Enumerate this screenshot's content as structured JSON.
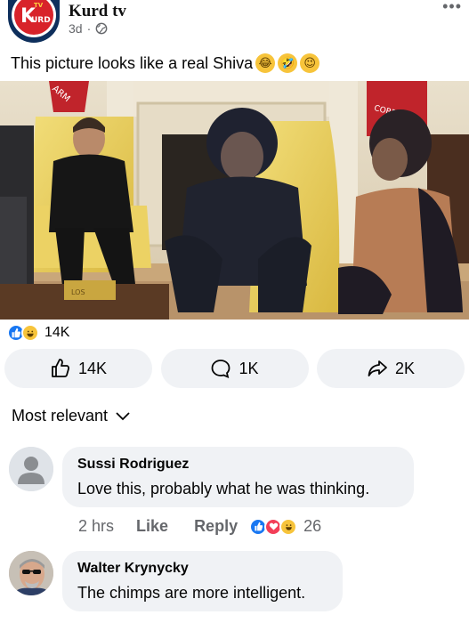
{
  "post": {
    "page_name": "Kurd tv",
    "time": "3d",
    "separator": "·",
    "caption": "This picture looks like a real Shiva",
    "logo_text": "KURD",
    "logo_badge": "TV",
    "caption_emojis": [
      "😂",
      "🤣",
      "😉"
    ],
    "photo_text": {
      "flag_left": "ARM",
      "flag_right": "CORPS",
      "box_label": "LOS"
    }
  },
  "reactions": {
    "count": "14K"
  },
  "actions": {
    "like": "14K",
    "comment": "1K",
    "share": "2K"
  },
  "sort_label": "Most relevant",
  "comments": [
    {
      "author": "Sussi Rodriguez",
      "text": "Love this, probably what he was thinking.",
      "time": "2 hrs",
      "like_label": "Like",
      "reply_label": "Reply",
      "reaction_count": "26"
    },
    {
      "author": "Walter Krynycky",
      "text": "The chimps are more intelligent."
    }
  ],
  "colors": {
    "accent": "#1877f2",
    "bubble": "#f0f2f5",
    "meta": "#65676b",
    "love": "#f33e58",
    "haha": "#f7c43b"
  }
}
